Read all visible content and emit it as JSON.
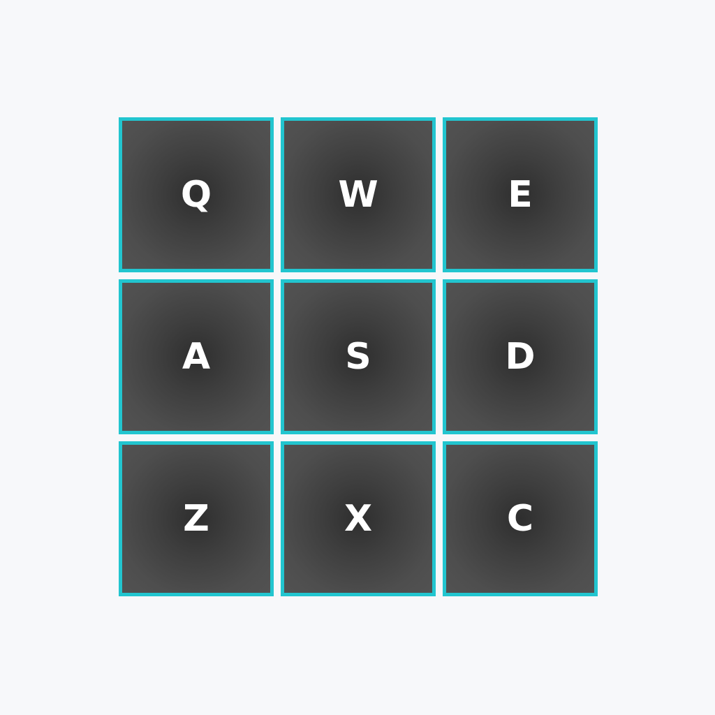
{
  "keypad": {
    "accent_color": "#22c5cf",
    "key_fill_color": "#4a4a4a",
    "label_color": "#ffffff",
    "background_color": "#f7f8fa",
    "keys": [
      {
        "label": "Q"
      },
      {
        "label": "W"
      },
      {
        "label": "E"
      },
      {
        "label": "A"
      },
      {
        "label": "S"
      },
      {
        "label": "D"
      },
      {
        "label": "Z"
      },
      {
        "label": "X"
      },
      {
        "label": "C"
      }
    ]
  }
}
